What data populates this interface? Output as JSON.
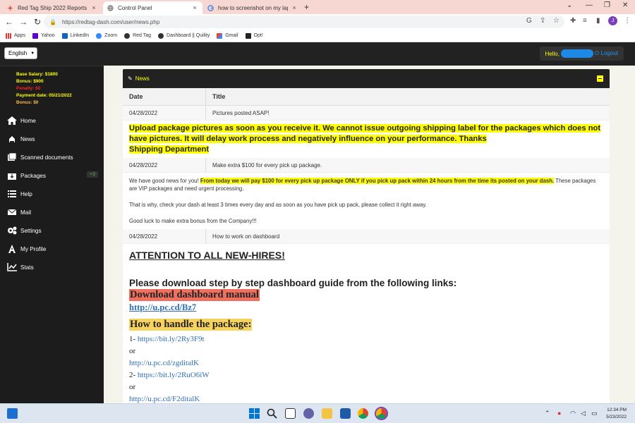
{
  "browser": {
    "tabs": [
      {
        "label": "Red Tag Ship 2022 Reports & Re",
        "close": "×"
      },
      {
        "label": "Control Panel",
        "close": "×"
      },
      {
        "label": "how to screenshot on my laptop",
        "close": "×"
      }
    ],
    "new_tab": "+",
    "window_controls": {
      "min": "—",
      "max": "❐",
      "close": "✕"
    },
    "nav": {
      "back": "←",
      "forward": "→",
      "reload": "↻"
    },
    "url": "https://redtag-dash.com/user/news.php",
    "profile_initial": "J",
    "bookmarks": [
      "Apps",
      "Yahoo",
      "LinkedIn",
      "Zoom",
      "Red Tag",
      "Dashboard || Quility",
      "Gmail",
      "Opt!"
    ]
  },
  "header": {
    "language": "English",
    "hello": "Hello,",
    "logout": "Logout"
  },
  "sidebar": {
    "base_salary": "Base Salary: $1800",
    "bonus": "Bonus: $900",
    "penalty": "Penalty: $0",
    "payment_date": "Payment date: 05/21/2022",
    "bonus2": "Bonus: $0",
    "items": [
      {
        "label": "Home",
        "icon": "home-icon"
      },
      {
        "label": "News",
        "icon": "news-icon"
      },
      {
        "label": "Scanned documents",
        "icon": "scanned-documents-icon"
      },
      {
        "label": "Packages",
        "icon": "packages-icon",
        "badge": "+3"
      },
      {
        "label": "Help",
        "icon": "help-icon"
      },
      {
        "label": "Mail",
        "icon": "mail-icon"
      },
      {
        "label": "Settings",
        "icon": "settings-icon"
      },
      {
        "label": "My Profile",
        "icon": "profile-icon"
      },
      {
        "label": "Stats",
        "icon": "stats-icon"
      }
    ]
  },
  "news": {
    "panel_title": "News",
    "col_date": "Date",
    "col_title": "Title",
    "items": [
      {
        "date": "04/28/2022",
        "title": "Pictures posted ASAP!",
        "body_line1": "Upload package pictures as soon as you receive it. We cannot issue outgoing shipping label for the packages which does not",
        "body_line2": "have pictures. It will delay work process and negatively influence on your performance. Thanks",
        "body_line3": "Shipping Department"
      },
      {
        "date": "04/28/2022",
        "title": "Make extra $100 for every pick up package.",
        "p1_start": "We have good news for you!",
        "p1_highlight": "From today we will pay $100 for every pick up package ONLY if you pick up pack within 24 hours from the time its posted on your dash.",
        "p1_end": "These packages are VIP packages and need urgent processing.",
        "p2": "That is why, check your dash at least 3 times every day and as soon as you have pick up pack, please collect it right away.",
        "p3": "Good luck to make extra bonus from the Company!!!"
      },
      {
        "date": "04/28/2022",
        "title": "How to work on dashboard",
        "attention": "ATTENTION TO ALL NEW-HIRES!",
        "download_intro": "Please download step by step dashboard guide from the following links:",
        "download_manual": "Download dashboard manual",
        "manual_link": "http://u.pc.cd/Bz7",
        "how_to": "How to handle the package:",
        "links": [
          {
            "prefix": "1- ",
            "text": "https://bit.ly/2Ry3F9t"
          },
          {
            "prefix": "",
            "text": "or"
          },
          {
            "prefix": "",
            "text": "http://u.pc.cd/zgditalK"
          },
          {
            "prefix": "2- ",
            "text": "https://bit.ly/2RuO6iW"
          },
          {
            "prefix": "",
            "text": "or"
          },
          {
            "prefix": "",
            "text": "http://u.pc.cd/F2ditalK"
          }
        ]
      }
    ]
  },
  "taskbar": {
    "time": "12:34 PM",
    "date": "5/23/2022"
  },
  "colors": {
    "highlight_yellow": "#ffff00",
    "salmon": "#f07060",
    "gold": "#f6d25e",
    "sidebar_bg": "#1c1c1c",
    "link_blue": "#2f6fba"
  }
}
